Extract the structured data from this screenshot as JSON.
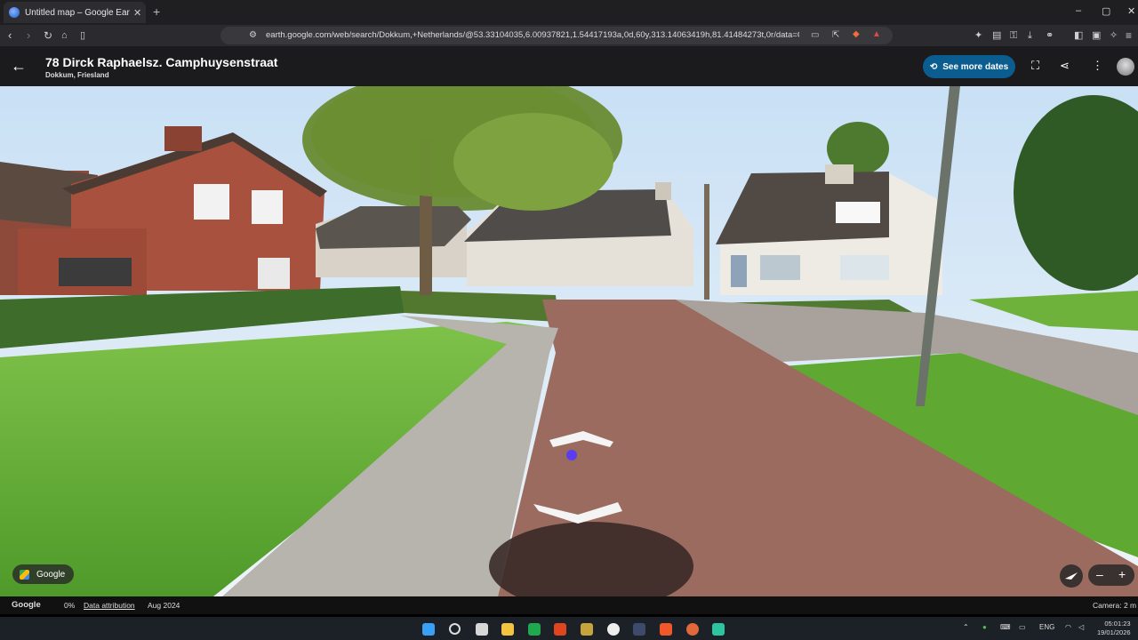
{
  "browser": {
    "tab_title": "Untitled map – Google Earth",
    "tab_close": "✕",
    "new_tab": "+",
    "url": "earth.google.com/web/search/Dokkum,+Netherlands/@53.33104035,6.00937821,1.54417193a,0d,60y,313.14063419h,81.41484273t,0r/data=Ci...",
    "win_min": "–",
    "win_max": "▢",
    "win_close": "✕"
  },
  "header": {
    "title": "78 Dirck Raphaelsz. Camphuysenstraat",
    "subtitle": "Dokkum, Friesland",
    "see_more_dates": "See more dates",
    "back_glyph": "←",
    "history_glyph": "⟲"
  },
  "view": {
    "attribution_badge": "Google",
    "zoom_minus": "–",
    "zoom_plus": "+"
  },
  "status": {
    "google": "Google",
    "percent": "0%",
    "data_attribution": "Data attribution",
    "date": "Aug 2024",
    "camera": "Camera: 2 m"
  },
  "taskbar": {
    "lang": "ENG",
    "time": "05:01:23",
    "date": "19/01/2026"
  },
  "colors": {
    "accent": "#0b5d8f",
    "header_bg": "#1b1b1e"
  }
}
